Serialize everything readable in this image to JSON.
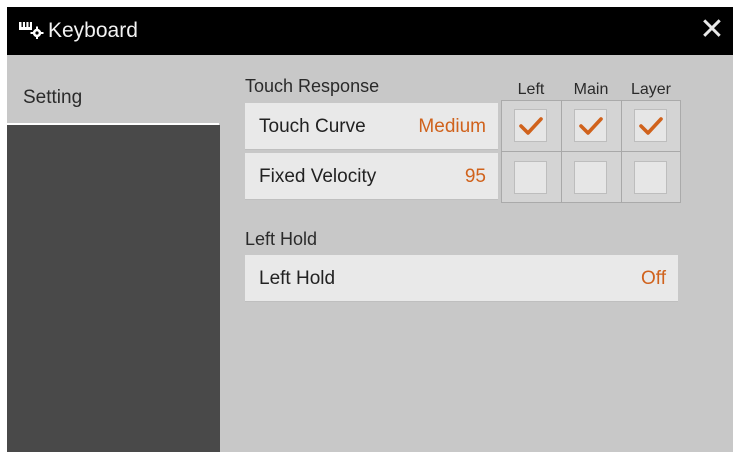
{
  "titlebar": {
    "icon": "keyboard-gear-icon",
    "title": "Keyboard",
    "close_label": "✕"
  },
  "sidebar": {
    "tabs": [
      {
        "label": "Setting",
        "selected": true
      }
    ]
  },
  "touch_response": {
    "section_label": "Touch Response",
    "columns": [
      "Left",
      "Main",
      "Layer"
    ],
    "rows": [
      {
        "label": "Touch Curve",
        "value": "Medium",
        "checks": [
          true,
          true,
          true
        ]
      },
      {
        "label": "Fixed Velocity",
        "value": "95",
        "checks": [
          false,
          false,
          false
        ]
      }
    ]
  },
  "left_hold": {
    "section_label": "Left Hold",
    "label": "Left Hold",
    "value": "Off"
  },
  "colors": {
    "accent": "#d0621c",
    "title_bar": "#000000",
    "background": "#c8c8c8",
    "side_panel": "#494949"
  }
}
